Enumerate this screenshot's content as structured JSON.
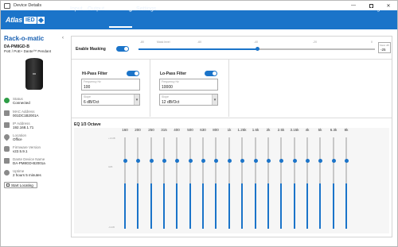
{
  "window": {
    "title": "Device Details",
    "min_glyph": "—",
    "close_glyph": "✕"
  },
  "navbar": {
    "logo": {
      "text": "Atlas",
      "ied": "IED"
    },
    "tabs": [
      {
        "label": "Input",
        "active": false
      },
      {
        "label": "Output",
        "active": false
      },
      {
        "label": "Masking",
        "active": true
      },
      {
        "label": "Settings",
        "active": false
      }
    ],
    "logout": "Logout"
  },
  "sidebar": {
    "device_name": "Rack-o-matic",
    "collapse_glyph": "‹",
    "model": "DA-PM8GD-B",
    "model_desc": "PoE / PoE+ Dante™ Pendant",
    "info": [
      {
        "icon": "check-circle-icon",
        "label": "Status",
        "value": "Connected",
        "color": "#2e9d46"
      },
      {
        "icon": "network-icon",
        "label": "MAC Address",
        "value": "001DC1B2001A",
        "color": "#8a8a8a"
      },
      {
        "icon": "ip-icon",
        "label": "IP Address",
        "value": "192.168.1.71",
        "color": "#8a8a8a"
      },
      {
        "icon": "location-pin-icon",
        "label": "Location",
        "value": "Office",
        "color": "#8a8a8a"
      },
      {
        "icon": "firmware-icon",
        "label": "Firmware Version",
        "value": "v22.5.9.1",
        "color": "#8a8a8a"
      },
      {
        "icon": "dante-name-icon",
        "label": "Dante Device Name",
        "value": "DA-PM8GD-B2001a",
        "color": "#8a8a8a"
      },
      {
        "icon": "clock-icon",
        "label": "Uptime",
        "value": "2 hours 5 minutes",
        "color": "#8a8a8a"
      }
    ],
    "start_locating": "Start Locating"
  },
  "masking": {
    "enable_label": "Enable Masking",
    "enabled": true,
    "scale_labels": [
      "-80",
      "Mask level",
      "-60",
      "-40",
      "-20",
      "0"
    ],
    "level_fraction": 0.5,
    "level_box_label": "Mask dB",
    "level_value": "-25"
  },
  "hipass": {
    "title": "Hi-Pass Filter",
    "enabled": true,
    "freq_label": "Frequency Hz",
    "freq_value": "100",
    "slope_label": "Slope",
    "slope_value": "6 dB/Oct"
  },
  "lopass": {
    "title": "Lo-Pass Filter",
    "enabled": true,
    "freq_label": "Frequency Hz",
    "freq_value": "10000",
    "slope_label": "Slope",
    "slope_value": "12 dB/Oct"
  },
  "eq": {
    "title": "EQ 1/3 Octave",
    "db_labels": [
      "+12dB",
      "0dB",
      "-12dB"
    ],
    "bands": [
      {
        "freq": "160",
        "gain_fraction": 0.5
      },
      {
        "freq": "200",
        "gain_fraction": 0.5
      },
      {
        "freq": "250",
        "gain_fraction": 0.5
      },
      {
        "freq": "315",
        "gain_fraction": 0.5
      },
      {
        "freq": "400",
        "gain_fraction": 0.5
      },
      {
        "freq": "500",
        "gain_fraction": 0.5
      },
      {
        "freq": "630",
        "gain_fraction": 0.5
      },
      {
        "freq": "800",
        "gain_fraction": 0.5
      },
      {
        "freq": "1k",
        "gain_fraction": 0.5
      },
      {
        "freq": "1.25k",
        "gain_fraction": 0.5
      },
      {
        "freq": "1.6k",
        "gain_fraction": 0.5
      },
      {
        "freq": "2k",
        "gain_fraction": 0.5
      },
      {
        "freq": "2.5k",
        "gain_fraction": 0.5
      },
      {
        "freq": "3.15k",
        "gain_fraction": 0.5
      },
      {
        "freq": "4k",
        "gain_fraction": 0.5
      },
      {
        "freq": "5k",
        "gain_fraction": 0.5
      },
      {
        "freq": "6.3k",
        "gain_fraction": 0.5
      },
      {
        "freq": "8k",
        "gain_fraction": 0.5
      }
    ]
  },
  "colors": {
    "accent": "#1b74c9",
    "status_ok": "#2e9d46"
  }
}
